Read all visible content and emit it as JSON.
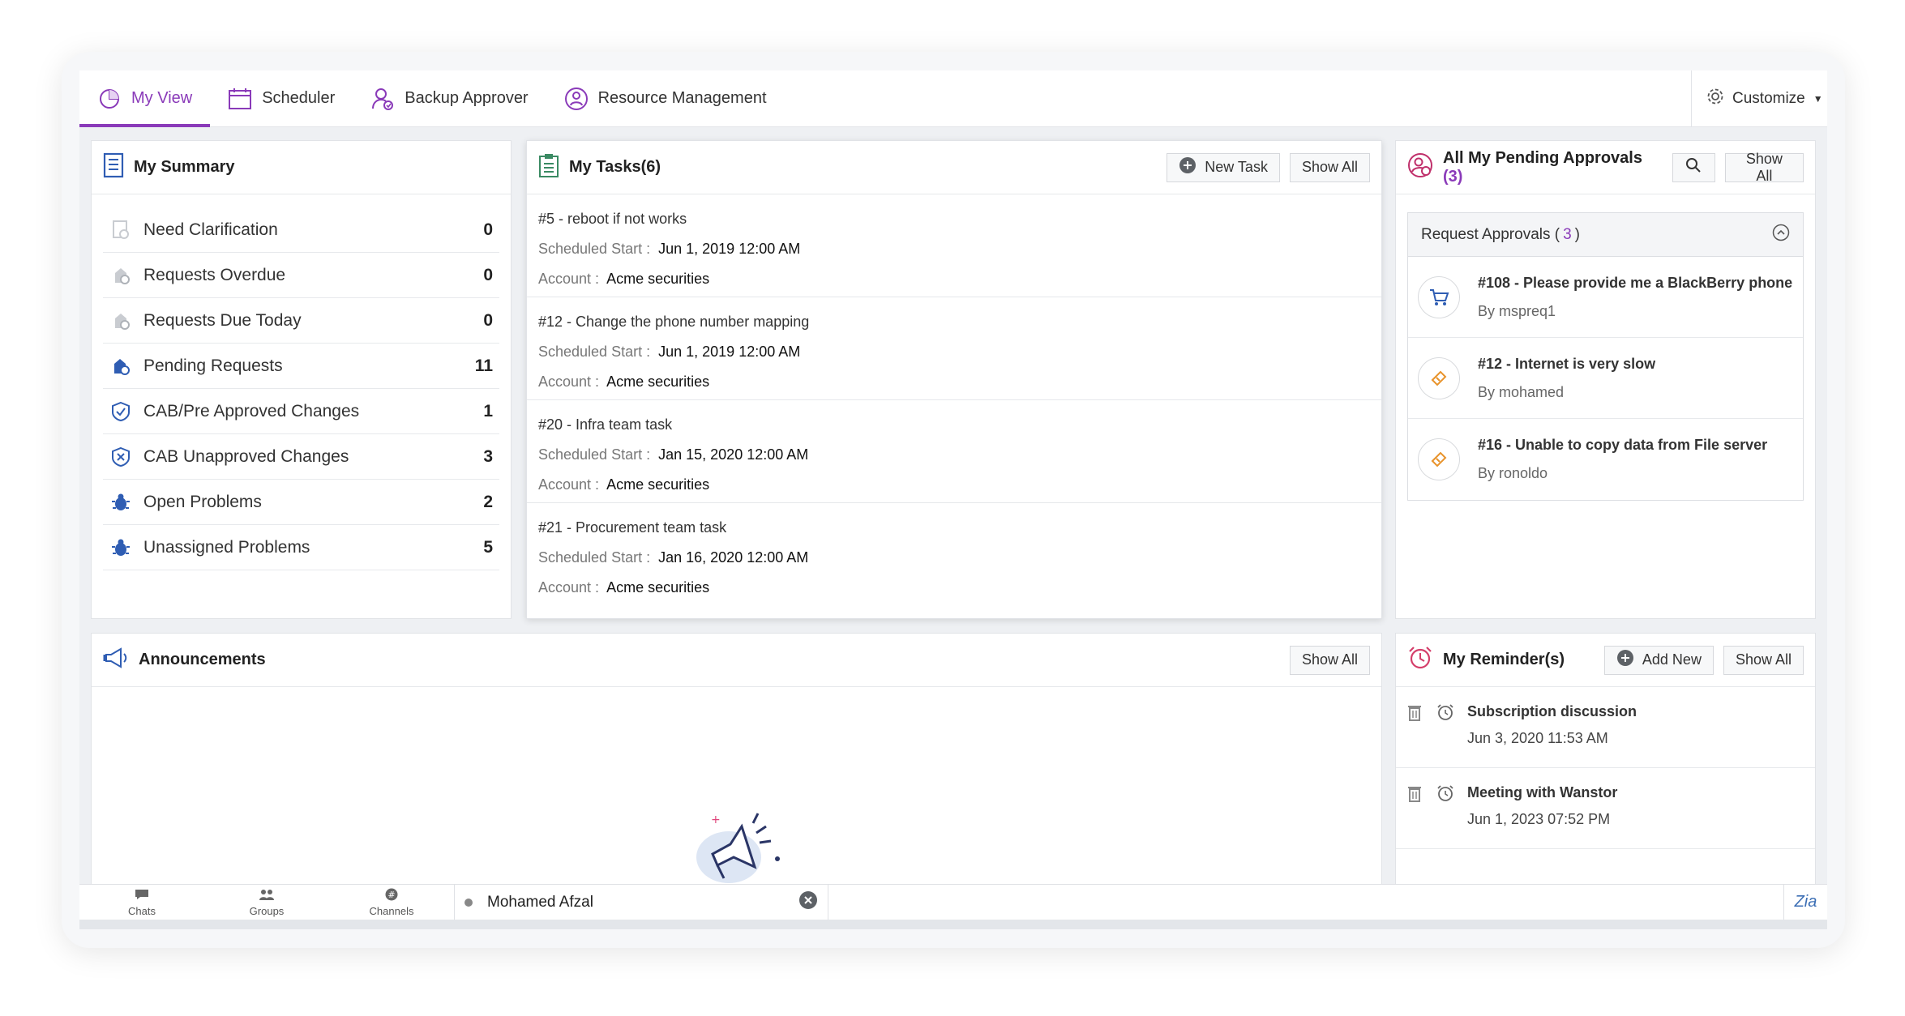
{
  "tabs": [
    {
      "label": "My View",
      "icon": "pie-chart-icon",
      "active": true
    },
    {
      "label": "Scheduler",
      "icon": "calendar-icon"
    },
    {
      "label": "Backup Approver",
      "icon": "user-check-icon"
    },
    {
      "label": "Resource Management",
      "icon": "users-circle-icon"
    }
  ],
  "customize_label": "Customize",
  "summary": {
    "title": "My Summary",
    "items": [
      {
        "label": "Need Clarification",
        "count": "0",
        "icon": "clarification-icon"
      },
      {
        "label": "Requests Overdue",
        "count": "0",
        "icon": "overdue-icon"
      },
      {
        "label": "Requests Due Today",
        "count": "0",
        "icon": "due-today-icon"
      },
      {
        "label": "Pending Requests",
        "count": "11",
        "icon": "pending-icon"
      },
      {
        "label": "CAB/Pre Approved Changes",
        "count": "1",
        "icon": "approved-change-icon"
      },
      {
        "label": "CAB Unapproved Changes",
        "count": "3",
        "icon": "unapproved-change-icon"
      },
      {
        "label": "Open Problems",
        "count": "2",
        "icon": "bug-icon"
      },
      {
        "label": "Unassigned Problems",
        "count": "5",
        "icon": "bug-icon"
      }
    ]
  },
  "tasks": {
    "title": "My Tasks(6)",
    "new_task": "New Task",
    "show_all": "Show All",
    "scheduled_label": "Scheduled Start :",
    "account_label": "Account :",
    "items": [
      {
        "title": "#5 - reboot if not works",
        "start": "Jun 1, 2019 12:00 AM",
        "account": "Acme securities"
      },
      {
        "title": "#12 - Change the phone number mapping",
        "start": "Jun 1, 2019 12:00 AM",
        "account": "Acme securities"
      },
      {
        "title": "#20 - Infra team task",
        "start": "Jan 15, 2020 12:00 AM",
        "account": "Acme securities"
      },
      {
        "title": "#21 - Procurement team task",
        "start": "Jan 16, 2020 12:00 AM",
        "account": "Acme securities"
      }
    ]
  },
  "approvals": {
    "title": "All My Pending Approvals",
    "title_count": "(3)",
    "show_all": "Show All",
    "group_label": "Request Approvals (",
    "group_count": "3",
    "group_close": ")",
    "items": [
      {
        "title": "#108 - Please provide me a BlackBerry phone",
        "by": "By mspreq1",
        "icon": "cart-icon"
      },
      {
        "title": "#12 - Internet is very slow",
        "by": "By mohamed",
        "icon": "ticket-icon"
      },
      {
        "title": "#16 - Unable to copy data from File server",
        "by": "By ronoldo",
        "icon": "ticket-icon"
      }
    ]
  },
  "announcements": {
    "title": "Announcements",
    "show_all": "Show All"
  },
  "reminders": {
    "title": "My Reminder(s)",
    "add_new": "Add New",
    "show_all": "Show All",
    "items": [
      {
        "title": "Subscription discussion",
        "date": "Jun 3, 2020 11:53 AM"
      },
      {
        "title": "Meeting with Wanstor",
        "date": "Jun 1, 2023 07:52 PM"
      }
    ]
  },
  "bottombar": {
    "chats": "Chats",
    "groups": "Groups",
    "channels": "Channels",
    "chat_user": "Mohamed Afzal",
    "zia": "Zia"
  },
  "colors": {
    "accent": "#8a3ab9",
    "brand_blue": "#2f5db3",
    "bg": "#eef0f3"
  }
}
